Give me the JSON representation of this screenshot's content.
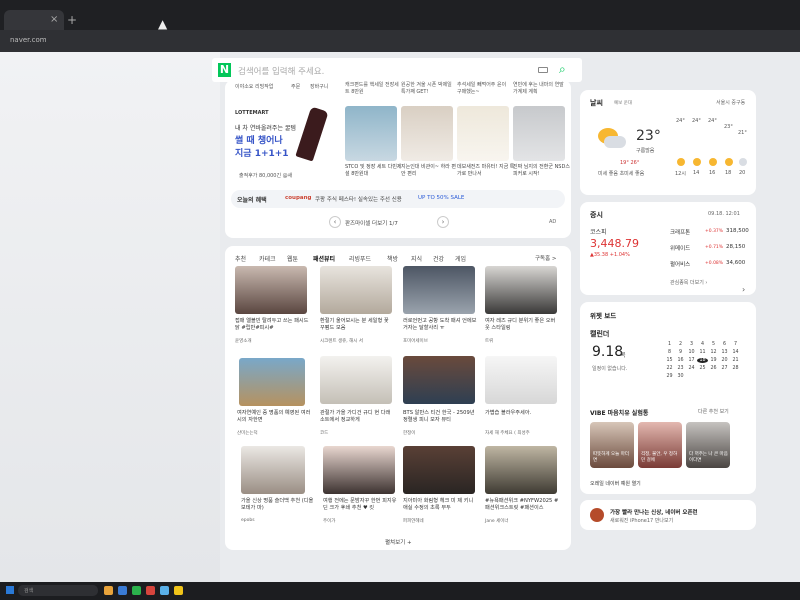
{
  "browser": {
    "url": "naver.com",
    "tab_close": "×",
    "new_tab": "+"
  },
  "search": {
    "logo": "N",
    "placeholder": "검색어를 입력해 주세요."
  },
  "shopping": {
    "top_items": [
      "이야소요 리빙작업",
      "주문",
      "장바구니",
      "캐크편드를 핵세일 전장세트 8만원",
      "원공한 겨울 시폰 박제일 특가째 GET!",
      "추석세일 빼먹어주 윤이 구매했는~",
      "연빈에 후는 내마의 연말가계제 계획"
    ],
    "ad_brand": "LOTTEMART",
    "ad_line1": "내 차 연바올려주는 꿀템",
    "ad_line2": "썰 때 챙어나",
    "ad_line3": "지금 1+1+1",
    "ad_sub": "출적후가 80,000긴 @새",
    "product_captions": [
      "STCO 및 정장 세트 다빈제설 8만원대",
      "지는인대 비관이~ 하라 편안 편리",
      "데보새전즈 마유터! 지금 특가로 만나서",
      "진짜 님지의 전환군 NSD스피커로 시작!"
    ],
    "benefit_title": "오늘의 혜택",
    "benefit_brand": "coupang",
    "benefit_text": "쿠팡 주식 페스타! 실속있는 주선 신용",
    "benefit_link": "UP TO 50% SALE",
    "pager_text": "판즈마이셀 더보기 1/7",
    "pager_prev": "‹",
    "pager_next": "›",
    "ad_mark": "AD"
  },
  "news": {
    "tabs": [
      "추천",
      "카테크",
      "웹툰",
      "패션뷰티",
      "리빙푸드",
      "책방",
      "지식",
      "건강",
      "게임"
    ],
    "active_tab": "패션뷰티",
    "subscribe": "구독홈 >",
    "items": [
      {
        "caption": "접매 엘블빈 탈려두고 쓰는 패시드 닭 #립반#피시#",
        "source": "윤영소개"
      },
      {
        "caption": "환절기 울어보시는 분 세일형 꽃 꾸펌드 모음",
        "source": "시크렌트 생쥬, 해시 서"
      },
      {
        "caption": "러로언먼고 공항 도착 패셔 언에보 거자는 달할사리 ㅠ",
        "source": "포미어세이브"
      },
      {
        "caption": "여자 레즈 규디 분위기 좋은 오버웃 스타일링",
        "source": "트뤼"
      },
      {
        "caption": "여자연예인 중 명품의 예영된 여러 시의 자한면",
        "source": "산미는는덕"
      },
      {
        "caption": "관절가 가을 가디건 규디 현 다래소트에서 정교하게",
        "source": "코드"
      },
      {
        "caption": "BTS 알만스 티건 한국 - 2509년 정렬생 피니 모자 뷰티",
        "source": "한정이"
      },
      {
        "caption": "가볍습 블라우주세아.",
        "source": "자세 해 주체요 ( 최성주"
      },
      {
        "caption": "가을 신상 명품 슬더백 추천 (디올 보테가 마)",
        "source": "epobs"
      },
      {
        "caption": "여행 전에는 문밤자꾸 한번 피지유딘 크가 후쇄 추천 ♥ 킷",
        "source": "주이가"
      },
      {
        "caption": "지아미아 화림형 헤크 미 제 키니 애실 수정의 초록 부두",
        "source": "퍼피얀헤네"
      },
      {
        "caption": "#뉴욕패션위크 #NYFW2025 #패션위크스트릿 #패션이스",
        "source": "Jane 세이너"
      }
    ],
    "more": "펼쳐보기 +"
  },
  "weather": {
    "title": "날씨",
    "subtitle": "예보 운대",
    "location": "서울시 중구동",
    "temp": "23°",
    "condition": "구름많음",
    "hilo": "19° 26°",
    "dust": "미세 좋음  초미세 좋음",
    "hour_temps": [
      "24°",
      "24°",
      "24°",
      "23°",
      "21°"
    ],
    "hour_labels": [
      "12시",
      "14",
      "16",
      "18",
      "20"
    ]
  },
  "stock": {
    "title": "증시",
    "time": "09.18. 12:01",
    "kospi_label": "코스피",
    "kospi_value": "3,448.79",
    "kospi_change": "▲35.38 +1.04%",
    "rows": [
      {
        "name": "크래프톤",
        "change": "+0.37%",
        "value": "318,500"
      },
      {
        "name": "위메이드",
        "change": "+0.71%",
        "value": "28,150"
      },
      {
        "name": "펄어비스",
        "change": "+0.08%",
        "value": "34,600"
      }
    ],
    "more": "관심종목 더보기 ›"
  },
  "widget": {
    "title": "위젯 보드",
    "calendar_title": "캘린더",
    "date": "9.18",
    "day": "목",
    "note": "일정이 없습니다.",
    "cal_days": [
      "1",
      "2",
      "3",
      "4",
      "5",
      "6",
      "7",
      "8",
      "9",
      "10",
      "11",
      "12",
      "13",
      "14",
      "15",
      "16",
      "17",
      "18",
      "19",
      "20",
      "21",
      "22",
      "23",
      "24",
      "25",
      "26",
      "27",
      "28",
      "29",
      "30",
      "",
      "",
      "",
      "",
      ""
    ],
    "today": "18",
    "vibe_title": "VIBE 마음치유 실험통",
    "vibe_more": "다른 추천 보기",
    "vibe_items": [
      "따뜻하게 오늘 마더면",
      "걱정, 불안, 우 정하던 걸에",
      "다 꺼주는 나 큰 마음이다면"
    ],
    "ai_promo": "오레일 네이버 예원 열기",
    "nav_arrow": "›"
  },
  "promo": {
    "line1": "가장 빨라 만나는 신상, 네이버 오픈런",
    "line2": "새로워진 iPhone17 만나보기"
  },
  "taskbar": {
    "search_label": "검색"
  },
  "colors": {
    "naver_green": "#03c75a",
    "accent_blue": "#3654c7",
    "up_red": "#d33"
  }
}
